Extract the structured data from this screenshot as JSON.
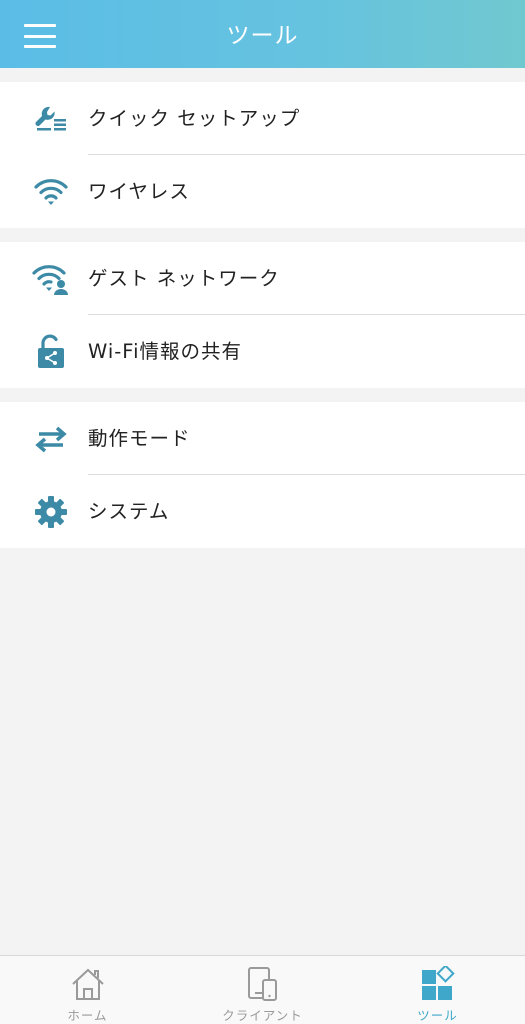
{
  "header": {
    "title": "ツール",
    "menu_icon": "hamburger-menu-icon"
  },
  "groups": [
    {
      "items": [
        {
          "label": "クイック セットアップ",
          "icon": "wrench-list-icon"
        },
        {
          "label": "ワイヤレス",
          "icon": "wifi-icon"
        }
      ]
    },
    {
      "items": [
        {
          "label": "ゲスト ネットワーク",
          "icon": "guest-wifi-icon"
        },
        {
          "label": "Wi-Fi情報の共有",
          "icon": "share-lock-icon"
        }
      ]
    },
    {
      "items": [
        {
          "label": "動作モード",
          "icon": "swap-arrows-icon"
        },
        {
          "label": "システム",
          "icon": "gear-icon"
        }
      ]
    }
  ],
  "tabbar": {
    "tabs": [
      {
        "label": "ホーム",
        "icon": "home-icon",
        "active": false
      },
      {
        "label": "クライアント",
        "icon": "devices-icon",
        "active": false
      },
      {
        "label": "ツール",
        "icon": "tools-grid-icon",
        "active": true
      }
    ]
  },
  "colors": {
    "accent": "#3fa7c9",
    "icon": "#3d8aa6",
    "header_start": "#5bbde6",
    "header_end": "#70c8cf"
  }
}
